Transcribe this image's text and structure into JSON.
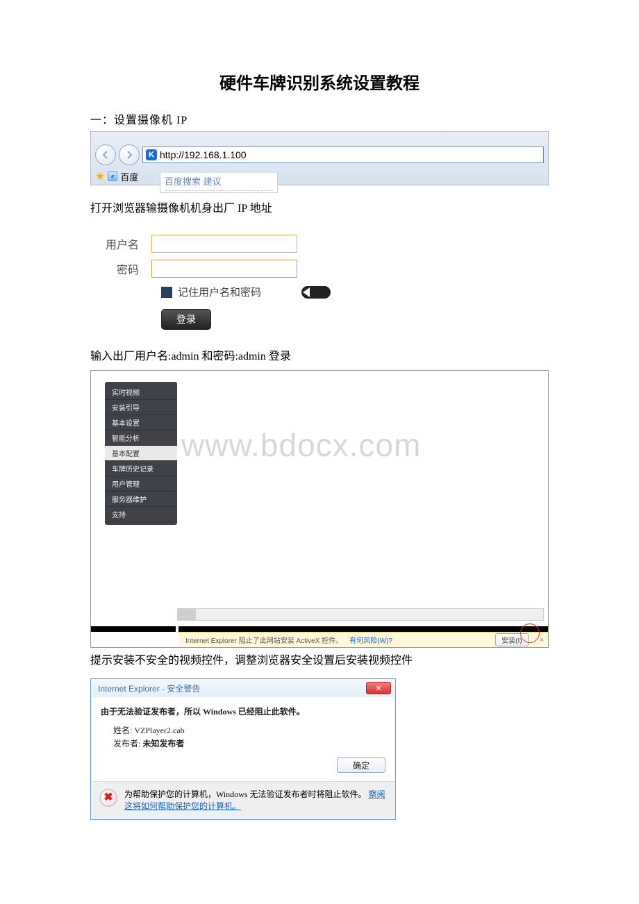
{
  "title": "硬件车牌识别系统设置教程",
  "section1": "一：设置摄像机 IP",
  "browser": {
    "url": "http://192.168.1.100",
    "suggest_label": "百度搜索 建议",
    "fav_label": "百度"
  },
  "text_after_browser": "打开浏览器输摄像机机身出厂 IP 地址",
  "login": {
    "user_label": "用户名",
    "pass_label": "密码",
    "remember": "记住用户名和密码",
    "button": "登录"
  },
  "text_after_login": "输入出厂用户名:admin 和密码:admin  登录",
  "watermark": "www.bdocx.com",
  "menu": {
    "items": [
      "实时视频",
      "安装引导",
      "基本设置",
      "智能分析",
      "基本配置",
      "车牌历史记录",
      "用户管理",
      "服务器维护",
      "支持"
    ],
    "selected_index": 4
  },
  "infobar": {
    "msg": "Internet Explorer 阻止了此网站安装 ActiveX 控件。",
    "risk": "有何风险(W)?",
    "install": "安装(I)"
  },
  "text_after_infobar": "提示安装不安全的视频控件，调整浏览器安全设置后安装视频控件",
  "dialog": {
    "title": "Internet Explorer  -  安全警告",
    "headline": "由于无法验证发布者，所以 Windows 已经阻止此软件。",
    "name_label": "姓名:",
    "name_value": "VZPlayer2.cab",
    "publisher_label": "发布者:",
    "publisher_value": "未知发布者",
    "ok": "确定",
    "footer_a": "为帮助保护您的计算机，Windows 无法验证发布者时将阻止软件。",
    "footer_link1": "察阅",
    "footer_link2": "这将如何帮助保护您的计算机。"
  }
}
